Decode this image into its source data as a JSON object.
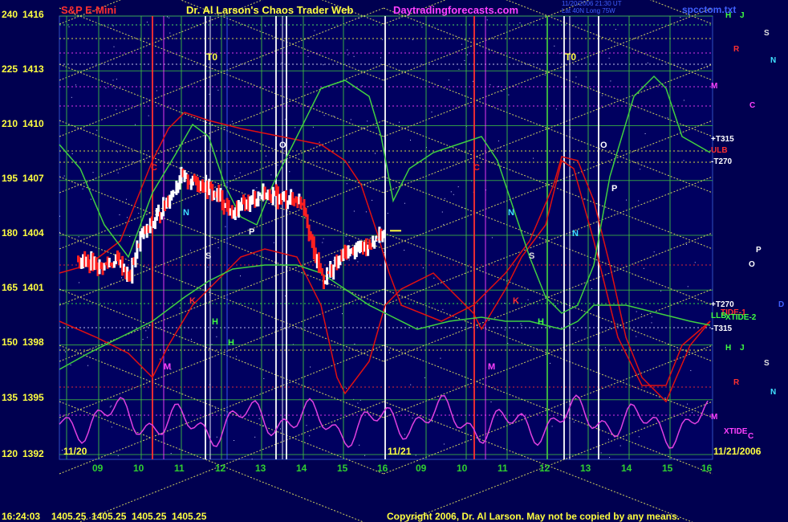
{
  "header": {
    "left_title": "S&P E-Mini",
    "center_title": "Dr. Al Larson's Chaos Trader Web",
    "site": "Daytradingforecasts.com",
    "stamp_line1": "11/20/2006 21:30 UT",
    "stamp_line2": "Lat 40N Long 75W",
    "file": "spcctom.txt"
  },
  "colors": {
    "background": "#000050",
    "plot_bg": "#000060",
    "axis_label": "#ffff40",
    "time_label": "#30d030",
    "title_red": "#ff3030",
    "title_yellow": "#ffff40",
    "site_magenta": "#ff40ff",
    "grid_green": "#40c040",
    "price_up": "#ffffff",
    "price_down": "#ff2020",
    "red_curve": "#e01010",
    "green_curve": "#40d040",
    "magenta_curve": "#e040e0"
  },
  "chart_data": {
    "type": "line",
    "title": "S&P E-Mini",
    "y_left_ticks": [
      "240",
      "225",
      "210",
      "195",
      "180",
      "165",
      "150",
      "135",
      "120"
    ],
    "y_right_ticks": [
      "1416",
      "1413",
      "1410",
      "1407",
      "1404",
      "1401",
      "1398",
      "1395",
      "1392"
    ],
    "ylim": [
      1392,
      1416
    ],
    "x_ticks": [
      "09",
      "10",
      "11",
      "12",
      "13",
      "14",
      "15",
      "16",
      "09",
      "10",
      "11",
      "12",
      "13",
      "14",
      "15",
      "16"
    ],
    "day_labels": [
      "11/20",
      "11/21",
      "11/21/2006"
    ],
    "series": [
      {
        "name": "S&P E-Mini 11/20",
        "points": [
          [
            8.5,
            1402.7
          ],
          [
            9.0,
            1402.3
          ],
          [
            9.5,
            1402.6
          ],
          [
            9.75,
            1401.6
          ],
          [
            10.0,
            1403.8
          ],
          [
            10.5,
            1405.2
          ],
          [
            10.75,
            1406.2
          ],
          [
            11.0,
            1407.1
          ],
          [
            11.5,
            1406.9
          ],
          [
            12.0,
            1406.0
          ],
          [
            12.25,
            1405.1
          ],
          [
            12.5,
            1405.6
          ],
          [
            13.0,
            1406.3
          ],
          [
            13.5,
            1406.0
          ],
          [
            14.0,
            1405.9
          ],
          [
            14.25,
            1403.0
          ],
          [
            14.5,
            1401.6
          ],
          [
            15.0,
            1403.0
          ],
          [
            15.5,
            1403.4
          ],
          [
            16.0,
            1404.2
          ]
        ]
      }
    ],
    "marker_letters": [
      "C",
      "N",
      "H",
      "H",
      "M",
      "S",
      "K",
      "O",
      "P",
      "C",
      "N",
      "S",
      "K",
      "H",
      "M",
      "O",
      "P",
      "N"
    ],
    "right_labels": [
      "H",
      "J",
      "S",
      "R",
      "N",
      "M",
      "C",
      "+T315",
      "ULB",
      "-T270",
      "P",
      "O",
      "+T270",
      "TIDE-1",
      "LLB",
      "XTIDE-2",
      "D",
      "-T315",
      "H",
      "J",
      "S",
      "R",
      "N",
      "M",
      "XTIDE",
      "C"
    ],
    "time_markers": [
      "T0",
      "T0"
    ],
    "footer": {
      "clock": "16:24:03",
      "quotes": [
        "1405.25",
        "1405.25",
        "1405.25",
        "1405.25"
      ],
      "copyright": "Copyright 2006, Dr. Al Larson. May not be copied by any means."
    }
  }
}
